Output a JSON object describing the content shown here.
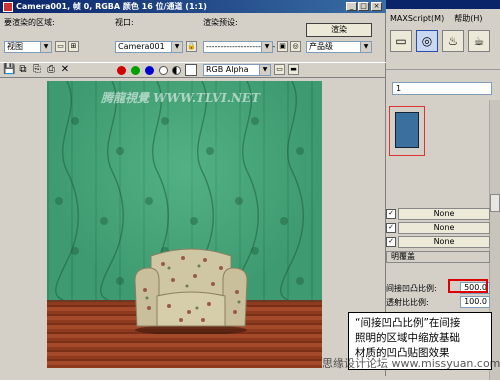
{
  "background_app": {
    "menu": [
      "MAXScript(M)",
      "帮助(H)"
    ],
    "dropdown_value": "1",
    "map_rows": [
      "None",
      "None",
      "None"
    ],
    "rollout_label": "明覆盖",
    "params": [
      {
        "label": "间接凹凸比例:",
        "value": "500.0"
      },
      {
        "label": "透射比比例:",
        "value": "100.0"
      }
    ]
  },
  "render_frame": {
    "title": "Camera001, 帧 0, RGBA 颜色 16 位/通道 (1:1)",
    "area_label": "要渲染的区域:",
    "area_value": "视图",
    "viewport_label": "视口:",
    "viewport_value": "Camera001",
    "preset_label": "渲染预设:",
    "preset_value": "------------------------",
    "render_button": "渲染",
    "product_level": "产品级",
    "channel_value": "RGB Alpha",
    "colors": {
      "red": "#d00000",
      "green": "#00a000",
      "blue": "#0000d0",
      "titlebar": "#0a246a",
      "wall": "#3e9a70",
      "floor": "#a4492a"
    }
  },
  "viewport": {
    "watermark": "腾龍視覺 WWW.TLVI.NET"
  },
  "annotation": {
    "lines": [
      "“间接凹凸比例”在间接",
      "照明的区域中缩放基础",
      "材质的凹凸贴图效果"
    ]
  },
  "bottom_watermark": "思缘设计论坛  www.missyuan.com"
}
